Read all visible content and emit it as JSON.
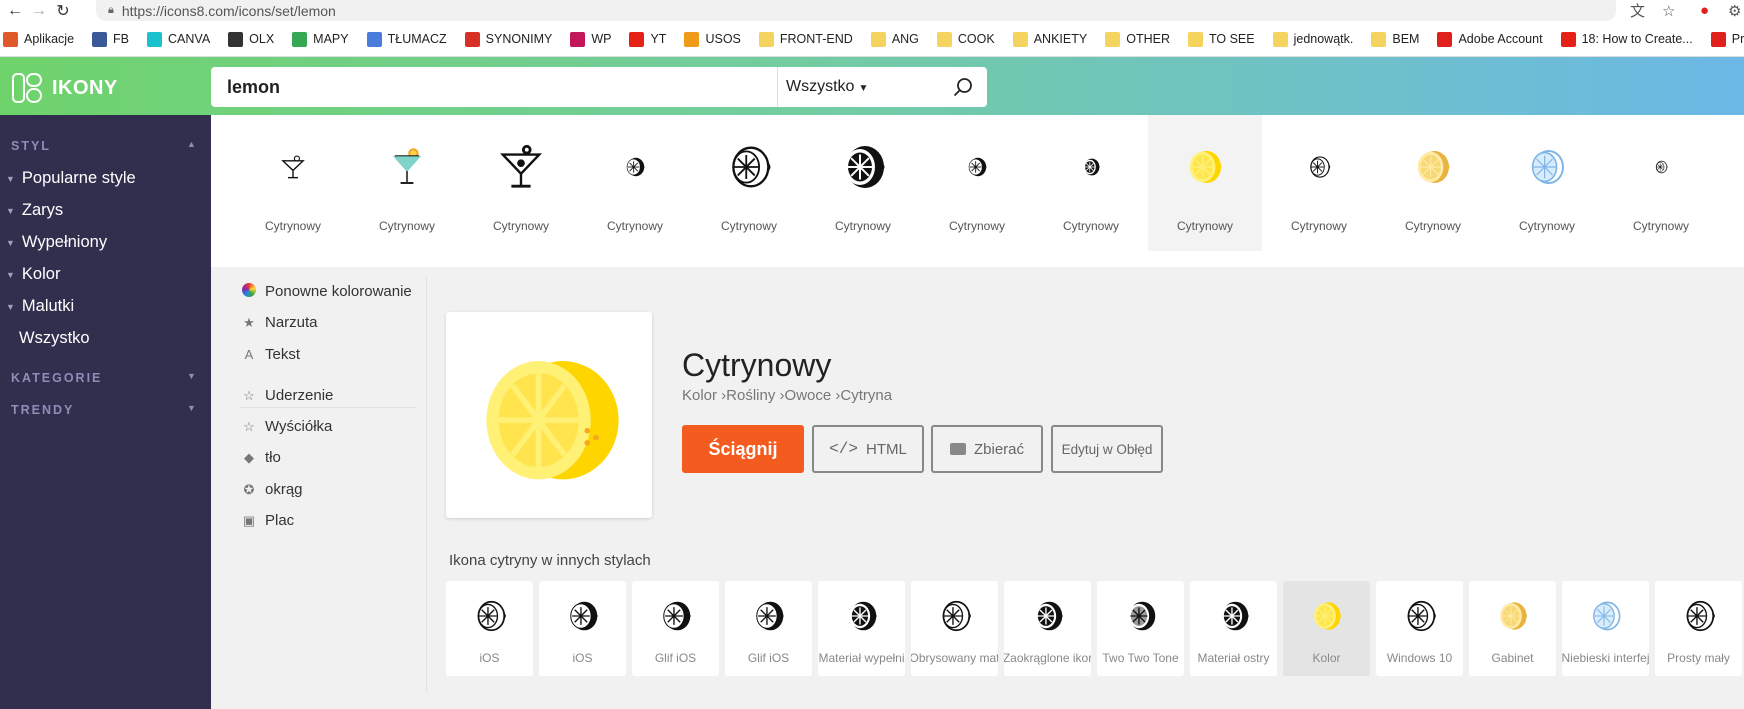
{
  "browser": {
    "url": "https://icons8.com/icons/set/lemon",
    "back_icon": "arrow-left-icon",
    "forward_icon": "arrow-right-icon",
    "reload_icon": "reload-icon"
  },
  "bookmarks": [
    {
      "label": "Aplikacje",
      "icon": "apps-grid-icon",
      "color": "#e0592a"
    },
    {
      "label": "FB",
      "icon": "facebook-icon",
      "color": "#3b5998"
    },
    {
      "label": "CANVA",
      "icon": "canva-icon",
      "color": "#19c2cc"
    },
    {
      "label": "OLX",
      "icon": "olx-icon",
      "color": "#333333"
    },
    {
      "label": "MAPY",
      "icon": "maps-icon",
      "color": "#34a853"
    },
    {
      "label": "TŁUMACZ",
      "icon": "translate-icon",
      "color": "#4a7ddb"
    },
    {
      "label": "SYNONIMY",
      "icon": "s-icon",
      "color": "#d93025"
    },
    {
      "label": "WP",
      "icon": "wp-icon",
      "color": "#c2185b"
    },
    {
      "label": "YT",
      "icon": "youtube-icon",
      "color": "#e62117"
    },
    {
      "label": "USOS",
      "icon": "u-icon",
      "color": "#f09a1a"
    },
    {
      "label": "FRONT-END",
      "icon": "folder-icon",
      "color": "#f4d35e"
    },
    {
      "label": "ANG",
      "icon": "folder-icon",
      "color": "#f4d35e"
    },
    {
      "label": "COOK",
      "icon": "folder-icon",
      "color": "#f4d35e"
    },
    {
      "label": "ANKIETY",
      "icon": "folder-icon",
      "color": "#f4d35e"
    },
    {
      "label": "OTHER",
      "icon": "folder-icon",
      "color": "#f4d35e"
    },
    {
      "label": "TO SEE",
      "icon": "folder-icon",
      "color": "#f4d35e"
    },
    {
      "label": "jednowątk.",
      "icon": "folder-icon",
      "color": "#f4d35e"
    },
    {
      "label": "BEM",
      "icon": "folder-icon",
      "color": "#f4d35e"
    },
    {
      "label": "Adobe Account",
      "icon": "adobe-icon",
      "color": "#e0201b"
    },
    {
      "label": "18: How to Create...",
      "icon": "youtube-icon",
      "color": "#e62117"
    },
    {
      "label": "Prototyping",
      "icon": "adobe-icon",
      "color": "#e0201b"
    }
  ],
  "header": {
    "brand": "IKONY",
    "search_value": "lemon",
    "filter_value": "Wszystko"
  },
  "sidebar": {
    "style_heading": "STYL",
    "items": [
      {
        "label": "Popularne style"
      },
      {
        "label": "Zarys"
      },
      {
        "label": "Wypełniony"
      },
      {
        "label": "Kolor"
      },
      {
        "label": "Malutki"
      }
    ],
    "all_label": "Wszystko",
    "categories_heading": "KATEGORIE",
    "trends_heading": "TRENDY"
  },
  "results": [
    {
      "label": "Cytrynowy",
      "icon": "cocktail-outline-icon"
    },
    {
      "label": "Cytrynowy",
      "icon": "cocktail-color-icon"
    },
    {
      "label": "Cytrynowy",
      "icon": "martini-icon"
    },
    {
      "label": "Cytrynowy",
      "icon": "lemon-small-icon"
    },
    {
      "label": "Cytrynowy",
      "icon": "lemon-outline-icon"
    },
    {
      "label": "Cytrynowy",
      "icon": "lemon-filled-icon"
    },
    {
      "label": "Cytrynowy",
      "icon": "lemon-small-icon"
    },
    {
      "label": "Cytrynowy",
      "icon": "lemon-tiny-icon"
    },
    {
      "label": "Cytrynowy",
      "icon": "lemon-yellow-icon"
    },
    {
      "label": "Cytrynowy",
      "icon": "lemon-line-icon"
    },
    {
      "label": "Cytrynowy",
      "icon": "lemon-pale-icon"
    },
    {
      "label": "Cytrynowy",
      "icon": "lemon-blue-icon"
    },
    {
      "label": "Cytrynowy",
      "icon": "lemon-micro-icon"
    }
  ],
  "tools": [
    {
      "label": "Ponowne kolorowanie",
      "icon": "recolor-icon"
    },
    {
      "label": "Narzuta",
      "icon": "overlay-icon"
    },
    {
      "label": "Tekst",
      "icon": "text-icon"
    },
    {
      "label": "Uderzenie",
      "icon": "stroke-icon"
    },
    {
      "label": "Wyściółka",
      "icon": "padding-icon"
    },
    {
      "label": "tło",
      "icon": "paint-bucket-icon"
    },
    {
      "label": "okrąg",
      "icon": "circle-icon"
    },
    {
      "label": "Plac",
      "icon": "square-icon"
    }
  ],
  "detail": {
    "title": "Cytrynowy",
    "breadcrumb": "Kolor ›Rośliny ›Owoce ›Cytryna",
    "download": "Ściągnij",
    "html": "HTML",
    "collect": "Zbierać",
    "edit": "Edytuj w Obłęd"
  },
  "other_styles_title": "Ikona cytryny w innych stylach",
  "styles": [
    {
      "label": "iOS",
      "icon": "lemon-ios-icon"
    },
    {
      "label": "iOS",
      "icon": "lemon-ios-filled-icon"
    },
    {
      "label": "Glif iOS",
      "icon": "lemon-glyph-icon"
    },
    {
      "label": "Glif iOS",
      "icon": "lemon-glyph-icon"
    },
    {
      "label": "Materiał wypełni",
      "icon": "lemon-material-filled-icon"
    },
    {
      "label": "Obrysowany mat",
      "icon": "lemon-material-outlined-icon"
    },
    {
      "label": "Zaokrąglone ikor",
      "icon": "lemon-rounded-icon"
    },
    {
      "label": "Two Two Tone",
      "icon": "lemon-two-tone-icon"
    },
    {
      "label": "Materiał ostry",
      "icon": "lemon-sharp-icon"
    },
    {
      "label": "Kolor",
      "icon": "lemon-color-icon"
    },
    {
      "label": "Windows 10",
      "icon": "lemon-windows-icon"
    },
    {
      "label": "Gabinet",
      "icon": "lemon-cabinet-icon"
    },
    {
      "label": "Niebieski interfej",
      "icon": "lemon-blue-ui-icon"
    },
    {
      "label": "Prosty mały",
      "icon": "lemon-simple-small-icon"
    }
  ],
  "colors": {
    "download_button": "#f45b1e",
    "sidebar_bg": "#312e4e",
    "lemon_yellow": "#ffd500"
  }
}
